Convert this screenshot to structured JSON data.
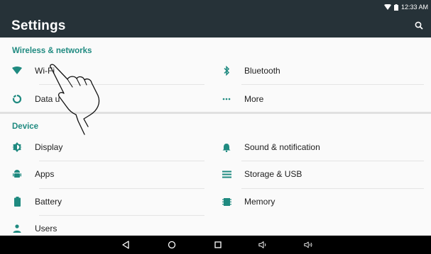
{
  "status": {
    "time": "12:33 AM"
  },
  "appbar": {
    "title": "Settings",
    "search_icon": "search-icon"
  },
  "sections": [
    {
      "header": "Wireless & networks"
    },
    {
      "header": "Device"
    }
  ],
  "wireless": {
    "wifi": "Wi-Fi",
    "bluetooth": "Bluetooth",
    "data": "Data u",
    "more": "More"
  },
  "device": {
    "display": "Display",
    "sound": "Sound & notification",
    "apps": "Apps",
    "storage": "Storage & USB",
    "battery": "Battery",
    "memory": "Memory",
    "users": "Users"
  },
  "colors": {
    "accent": "#1f8a80",
    "appbar": "#263238",
    "navbar": "#000000"
  }
}
